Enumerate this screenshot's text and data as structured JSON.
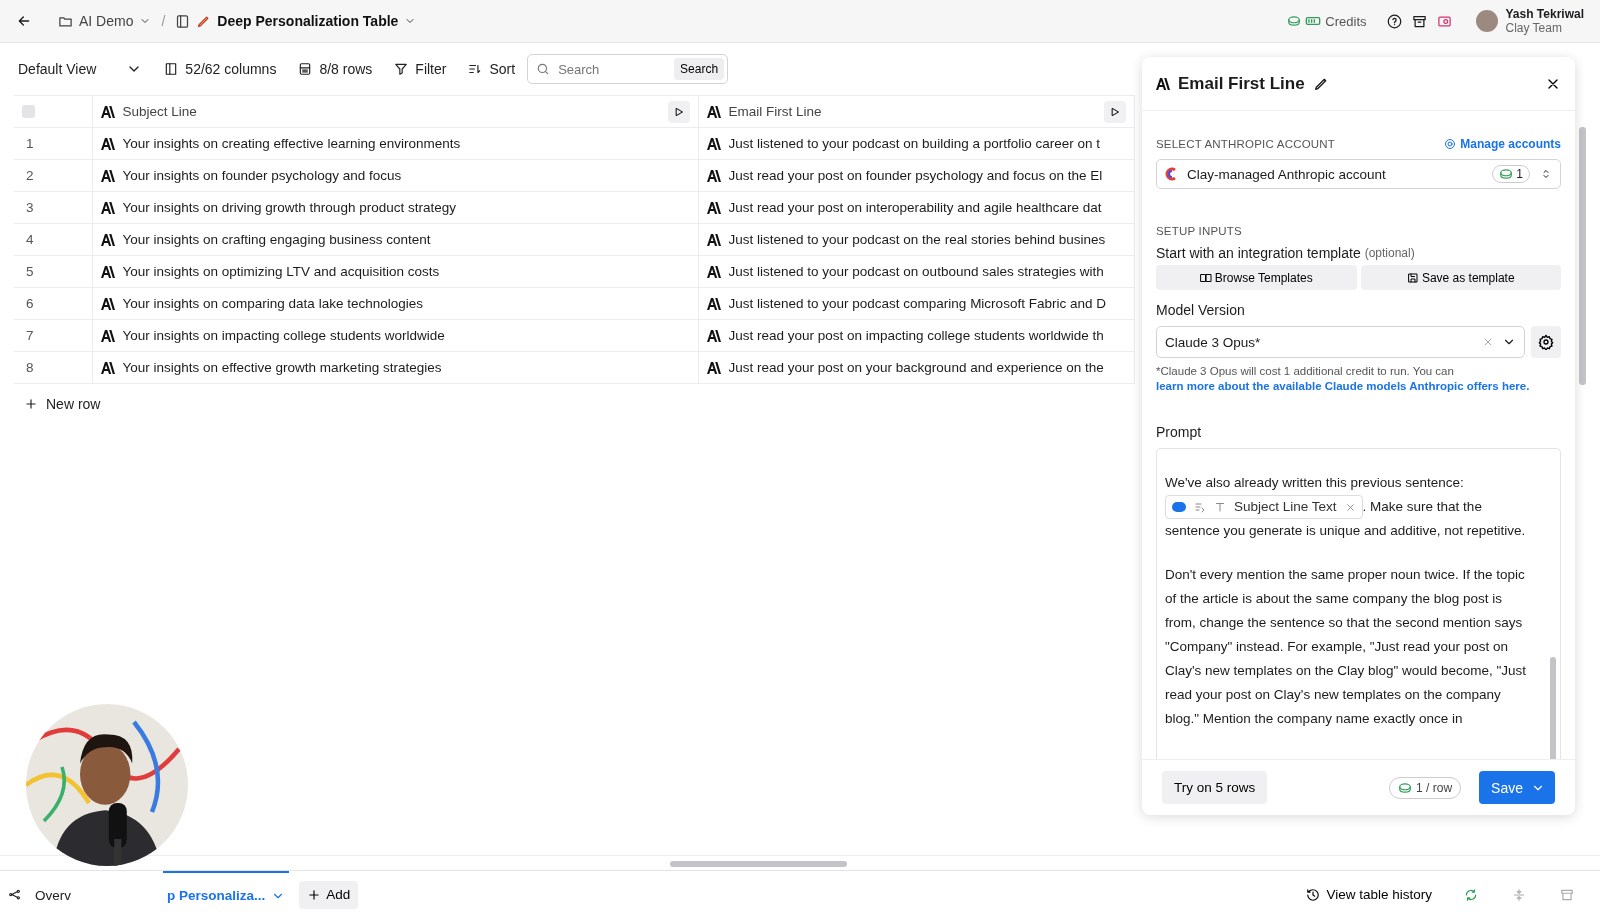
{
  "breadcrumb": {
    "folder": "AI Demo",
    "separator": "/",
    "table": "Deep Personalization Table"
  },
  "header": {
    "credits": "Credits",
    "user": {
      "name": "Yash Tekriwal",
      "team": "Clay Team"
    }
  },
  "toolbar": {
    "view": "Default View",
    "columns": "52/62 columns",
    "rows": "8/8 rows",
    "filter": "Filter",
    "sort": "Sort",
    "search": {
      "placeholder": "Search",
      "button": "Search"
    }
  },
  "table": {
    "select_all": {
      "checked": false
    },
    "columns": [
      {
        "name": "Subject Line"
      },
      {
        "name": "Email First Line"
      }
    ],
    "rows": [
      {
        "number": "1",
        "subject": "Your insights on creating effective learning environments",
        "email": "Just listened to your podcast on building a portfolio career on t"
      },
      {
        "number": "2",
        "subject": "Your insights on founder psychology and focus",
        "email": "Just read your post on founder psychology and focus on the El"
      },
      {
        "number": "3",
        "subject": "Your insights on driving growth through product strategy",
        "email": "Just read your post on interoperability and agile healthcare dat"
      },
      {
        "number": "4",
        "subject": "Your insights on crafting engaging business content",
        "email": "Just listened to your podcast on the real stories behind busines"
      },
      {
        "number": "5",
        "subject": "Your insights on optimizing LTV and acquisition costs",
        "email": "Just listened to your podcast on outbound sales strategies with"
      },
      {
        "number": "6",
        "subject": "Your insights on comparing data lake technologies",
        "email": "Just listened to your podcast comparing Microsoft Fabric and D"
      },
      {
        "number": "7",
        "subject": "Your insights on impacting college students worldwide",
        "email": "Just read your post on impacting college students worldwide th"
      },
      {
        "number": "8",
        "subject": "Your insights on effective growth marketing strategies",
        "email": "Just read your post on your background and experience on the"
      }
    ],
    "new_row": "New row"
  },
  "panel": {
    "title": "Email First Line",
    "account_label": "SELECT ANTHROPIC ACCOUNT",
    "manage": "Manage accounts",
    "account": "Clay-managed Anthropic account",
    "account_credits": "1",
    "setup_label": "SETUP INPUTS",
    "template_label": "Start with an integration template",
    "optional": "(optional)",
    "browse": "Browse Templates",
    "save_template": "Save as template",
    "model_label": "Model Version",
    "model": "Claude 3 Opus*",
    "note": "*Claude 3 Opus will cost 1 additional credit to run. You can",
    "note_link": "learn more about the available Claude models Anthropic offers here.",
    "prompt_label": "Prompt",
    "prompt": {
      "before": "We've also already written this previous sentence:",
      "chip": "Subject Line Text",
      "after": ". Make sure that the sentence you generate is unique and additive, not repetitive.",
      "paragraph": "Don't every mention the same proper noun twice. If the topic of the article is about the same company the blog post is from, change the sentence so that the second mention says \"Company\" instead. For example, \"Just read your post on Clay's new templates on the Clay blog\" would become, \"Just read your post on Clay's new templates on the company blog.\" Mention the company name exactly once in"
    },
    "try": "Try on 5 rows",
    "cost": "1 / row",
    "save": "Save"
  },
  "bottom": {
    "tabs": [
      {
        "label": "Overv",
        "selected": false
      },
      {
        "label": "p Personaliza...",
        "selected": true
      }
    ],
    "add": "Add",
    "history": "View table history"
  }
}
